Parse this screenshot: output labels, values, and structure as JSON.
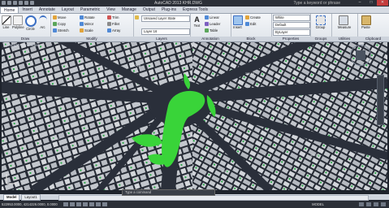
{
  "title": "AutoCAD 2013   KHR.DWG",
  "help_text": "Type a keyword or phrase",
  "tabs": [
    "Home",
    "Insert",
    "Annotate",
    "Layout",
    "Parametric",
    "View",
    "Manage",
    "Output",
    "Plug-ins",
    "Express Tools"
  ],
  "active_tab": "Home",
  "draw": {
    "line": "Line",
    "polyline": "Polyline",
    "circle": "Circle",
    "arc": "Arc",
    "label": "Draw"
  },
  "modify": {
    "move": "Move",
    "rotate": "Rotate",
    "trim": "Trim",
    "copy": "Copy",
    "mirror": "Mirror",
    "fillet": "Fillet",
    "stretch": "Stretch",
    "scale": "Scale",
    "array": "Array",
    "label": "Modify"
  },
  "layers": {
    "current": "Unsaved Layer State",
    "layer": "Layer 16",
    "label": "Layers"
  },
  "annotation": {
    "text": "Text",
    "linear": "Linear",
    "leader": "Leader",
    "table": "Table",
    "label": "Annotation"
  },
  "block": {
    "insert": "Insert",
    "create": "Create",
    "edit": "Edit",
    "label": "Block"
  },
  "properties": {
    "color": "White",
    "linetype": "Default",
    "lineweight": "ByLayer",
    "label": "Properties"
  },
  "groups": {
    "group": "Group",
    "label": "Groups"
  },
  "utilities": {
    "measure": "Measure",
    "label": "Utilities"
  },
  "clipboard": {
    "paste": "Paste",
    "label": "Clipboard"
  },
  "viewport_label": "[-][Top][2D Wireframe]",
  "command_prompt": "Type a command",
  "layout_tabs": [
    "Model",
    "Layout1"
  ],
  "status_coords": "522953.0000, 4214226.0000, 0.0000",
  "status_model": "MODEL",
  "colors": {
    "canvas": "#1c2028",
    "building": "#c9ccd1",
    "green": "#39d439",
    "road": "#2a2f3a"
  }
}
